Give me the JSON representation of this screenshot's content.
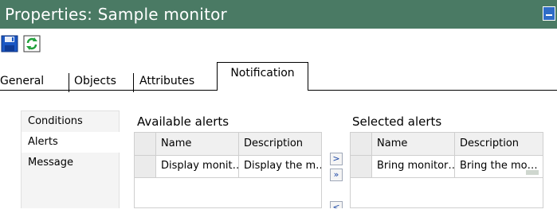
{
  "window": {
    "title": "Properties: Sample monitor"
  },
  "toolbar": {
    "save_icon": "save-icon",
    "refresh_icon": "refresh-icon"
  },
  "tabs": [
    {
      "label": "General"
    },
    {
      "label": "Objects"
    },
    {
      "label": "Attributes"
    },
    {
      "label": "Notification",
      "active": true
    }
  ],
  "nav": {
    "items": [
      {
        "label": "Conditions"
      },
      {
        "label": "Alerts",
        "active": true
      },
      {
        "label": "Message"
      }
    ]
  },
  "available": {
    "label": "Available alerts",
    "columns": [
      "Name",
      "Description"
    ],
    "rows": [
      {
        "name": "Display monit…",
        "description": "Display the m…"
      }
    ]
  },
  "selected": {
    "label": "Selected alerts",
    "columns": [
      "Name",
      "Description"
    ],
    "rows": [
      {
        "name": "Bring monitor…",
        "description": "Bring the mo…"
      }
    ]
  },
  "move_buttons": {
    "add": ">",
    "add_all": "»",
    "remove": "<"
  },
  "colors": {
    "titlebar": "#4a7a64",
    "active_nav": "#ffffff",
    "grid_header": "#f0f0f0"
  }
}
